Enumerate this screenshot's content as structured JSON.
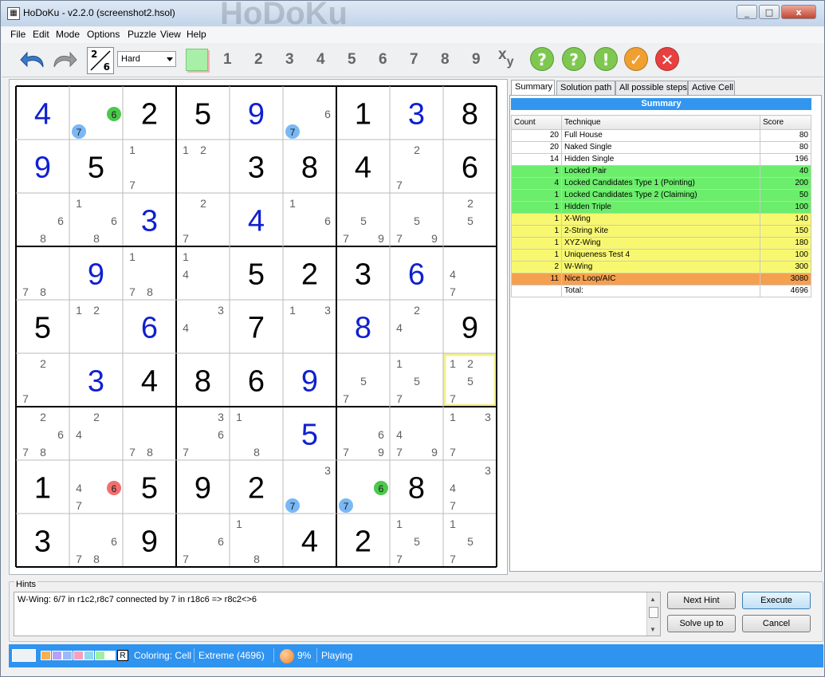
{
  "window": {
    "title": "HoDoKu - v2.2.0  (screenshot2.hsol)",
    "watermark": "HoDoKu",
    "min": "_",
    "max": "□",
    "close": "x"
  },
  "menu": [
    "File",
    "Edit",
    "Mode",
    "Options",
    "Puzzle",
    "View",
    "Help"
  ],
  "toolbar": {
    "filter_icon": {
      "top": "2",
      "bottom": "6"
    },
    "level": "Hard",
    "digits": [
      "1",
      "2",
      "3",
      "4",
      "5",
      "6",
      "7",
      "8",
      "9"
    ],
    "xy": "x",
    "xy_sub": "y",
    "hint_buttons": [
      "?",
      "?",
      "!",
      "✓",
      "✕"
    ],
    "colors": {
      "undo": "#3a78c8",
      "redo": "#8a8a8a",
      "green_circle": "#7ec850",
      "orange_circle": "#f0a030",
      "red_circle": "#e84040",
      "swatch": "#a8f0a8"
    }
  },
  "board": {
    "colors": {
      "given": "#000000",
      "solved": "#1020d0",
      "candidate": "#606060",
      "blue_mark": "#7ab8f5",
      "green_mark": "#4cc84c",
      "red_mark": "#f07070",
      "highlight": "#f5f08c"
    },
    "cells": [
      [
        {
          "v": "4",
          "t": "s"
        },
        {
          "c": [
            "6",
            "7"
          ],
          "mark": {
            "6": "green",
            "7": "blue"
          }
        },
        {
          "v": "2",
          "t": "g"
        },
        {
          "v": "5",
          "t": "g"
        },
        {
          "v": "9",
          "t": "s"
        },
        {
          "c": [
            "6",
            "7"
          ],
          "mark": {
            "7": "blue"
          }
        },
        {
          "v": "1",
          "t": "g"
        },
        {
          "v": "3",
          "t": "s"
        },
        {
          "v": "8",
          "t": "g"
        }
      ],
      [
        {
          "v": "9",
          "t": "s"
        },
        {
          "v": "5",
          "t": "g"
        },
        {
          "c": [
            "1",
            "7"
          ]
        },
        {
          "c": [
            "1",
            "2"
          ]
        },
        {
          "v": "3",
          "t": "g"
        },
        {
          "v": "8",
          "t": "g"
        },
        {
          "v": "4",
          "t": "g"
        },
        {
          "c": [
            "2",
            "7"
          ]
        },
        {
          "v": "6",
          "t": "g"
        }
      ],
      [
        {
          "c": [
            "6",
            "8"
          ]
        },
        {
          "c": [
            "1",
            "6",
            "8"
          ]
        },
        {
          "v": "3",
          "t": "s"
        },
        {
          "c": [
            "2",
            "7"
          ]
        },
        {
          "v": "4",
          "t": "s"
        },
        {
          "c": [
            "1",
            "6"
          ]
        },
        {
          "c": [
            "5",
            "7",
            "9"
          ]
        },
        {
          "c": [
            "5",
            "7",
            "9"
          ]
        },
        {
          "c": [
            "2",
            "5"
          ]
        }
      ],
      [
        {
          "c": [
            "7",
            "8"
          ]
        },
        {
          "v": "9",
          "t": "s"
        },
        {
          "c": [
            "1",
            "7",
            "8"
          ]
        },
        {
          "c": [
            "1",
            "4"
          ]
        },
        {
          "v": "5",
          "t": "g"
        },
        {
          "v": "2",
          "t": "g"
        },
        {
          "v": "3",
          "t": "g"
        },
        {
          "v": "6",
          "t": "s"
        },
        {
          "c": [
            "4",
            "7"
          ]
        }
      ],
      [
        {
          "v": "5",
          "t": "g"
        },
        {
          "c": [
            "1",
            "2"
          ]
        },
        {
          "v": "6",
          "t": "s"
        },
        {
          "c": [
            "3",
            "4"
          ]
        },
        {
          "v": "7",
          "t": "g"
        },
        {
          "c": [
            "1",
            "3"
          ]
        },
        {
          "v": "8",
          "t": "s"
        },
        {
          "c": [
            "2",
            "4"
          ]
        },
        {
          "v": "9",
          "t": "g"
        }
      ],
      [
        {
          "c": [
            "2",
            "7"
          ]
        },
        {
          "v": "3",
          "t": "s"
        },
        {
          "v": "4",
          "t": "g"
        },
        {
          "v": "8",
          "t": "g"
        },
        {
          "v": "6",
          "t": "g"
        },
        {
          "v": "9",
          "t": "s"
        },
        {
          "c": [
            "5",
            "7"
          ]
        },
        {
          "c": [
            "1",
            "5",
            "7"
          ]
        },
        {
          "c": [
            "1",
            "2",
            "5",
            "7"
          ],
          "hl": true
        }
      ],
      [
        {
          "c": [
            "2",
            "6",
            "7",
            "8"
          ]
        },
        {
          "c": [
            "2",
            "4"
          ]
        },
        {
          "c": [
            "7",
            "8"
          ]
        },
        {
          "c": [
            "3",
            "6",
            "7"
          ]
        },
        {
          "c": [
            "1",
            "8"
          ]
        },
        {
          "v": "5",
          "t": "s"
        },
        {
          "c": [
            "6",
            "7",
            "9"
          ]
        },
        {
          "c": [
            "4",
            "7",
            "9"
          ]
        },
        {
          "c": [
            "1",
            "3",
            "7"
          ]
        }
      ],
      [
        {
          "v": "1",
          "t": "g"
        },
        {
          "c": [
            "4",
            "6",
            "7"
          ],
          "mark": {
            "6": "red"
          }
        },
        {
          "v": "5",
          "t": "g"
        },
        {
          "v": "9",
          "t": "g"
        },
        {
          "v": "2",
          "t": "g"
        },
        {
          "c": [
            "3",
            "7"
          ],
          "mark": {
            "7": "blue"
          }
        },
        {
          "c": [
            "6",
            "7"
          ],
          "mark": {
            "6": "green",
            "7": "blue"
          }
        },
        {
          "v": "8",
          "t": "g"
        },
        {
          "c": [
            "3",
            "4",
            "7"
          ]
        }
      ],
      [
        {
          "v": "3",
          "t": "g"
        },
        {
          "c": [
            "6",
            "7",
            "8"
          ]
        },
        {
          "v": "9",
          "t": "g"
        },
        {
          "c": [
            "6",
            "7"
          ]
        },
        {
          "c": [
            "1",
            "8"
          ]
        },
        {
          "v": "4",
          "t": "g"
        },
        {
          "v": "2",
          "t": "g"
        },
        {
          "c": [
            "1",
            "5",
            "7"
          ]
        },
        {
          "c": [
            "1",
            "5",
            "7"
          ]
        }
      ]
    ]
  },
  "tabs": [
    "Summary",
    "Solution path",
    "All possible steps",
    "Active Cell"
  ],
  "summary": {
    "header": "Summary",
    "columns": [
      "Count",
      "Technique",
      "Score"
    ],
    "row_colors": {
      "white": "#ffffff",
      "green": "#6bee6b",
      "yellow": "#f8f870",
      "orange": "#f4a050"
    },
    "rows": [
      {
        "count": "20",
        "tech": "Full House",
        "score": "80",
        "color": "white"
      },
      {
        "count": "20",
        "tech": "Naked Single",
        "score": "80",
        "color": "white"
      },
      {
        "count": "14",
        "tech": "Hidden Single",
        "score": "196",
        "color": "white"
      },
      {
        "count": "1",
        "tech": "Locked Pair",
        "score": "40",
        "color": "green"
      },
      {
        "count": "4",
        "tech": "Locked Candidates Type 1 (Pointing)",
        "score": "200",
        "color": "green"
      },
      {
        "count": "1",
        "tech": "Locked Candidates Type 2 (Claiming)",
        "score": "50",
        "color": "green"
      },
      {
        "count": "1",
        "tech": "Hidden Triple",
        "score": "100",
        "color": "green"
      },
      {
        "count": "1",
        "tech": "X-Wing",
        "score": "140",
        "color": "yellow"
      },
      {
        "count": "1",
        "tech": "2-String Kite",
        "score": "150",
        "color": "yellow"
      },
      {
        "count": "1",
        "tech": "XYZ-Wing",
        "score": "180",
        "color": "yellow"
      },
      {
        "count": "1",
        "tech": "Uniqueness Test 4",
        "score": "100",
        "color": "yellow"
      },
      {
        "count": "2",
        "tech": "W-Wing",
        "score": "300",
        "color": "yellow"
      },
      {
        "count": "11",
        "tech": "Nice Loop/AIC",
        "score": "3080",
        "color": "orange"
      },
      {
        "count": "",
        "tech": "Total:",
        "score": "4696",
        "color": "white"
      }
    ]
  },
  "hints": {
    "label": "Hints",
    "text": "W-Wing: 6/7 in r1c2,r8c7 connected by 7 in r18c6 => r8c2<>6",
    "buttons": {
      "next_hint": "Next Hint",
      "execute": "Execute",
      "solve_up_to": "Solve up to",
      "cancel": "Cancel"
    }
  },
  "status": {
    "swatches": [
      "#f8b050",
      "#b8a0f8",
      "#a0b8f8",
      "#f8a0c0",
      "#90d8f0",
      "#a0f0a0",
      "#ffffff"
    ],
    "r_label": "R",
    "coloring": "Coloring: Cell",
    "level": "Extreme (4696)",
    "progress": "9%",
    "mode": "Playing"
  }
}
